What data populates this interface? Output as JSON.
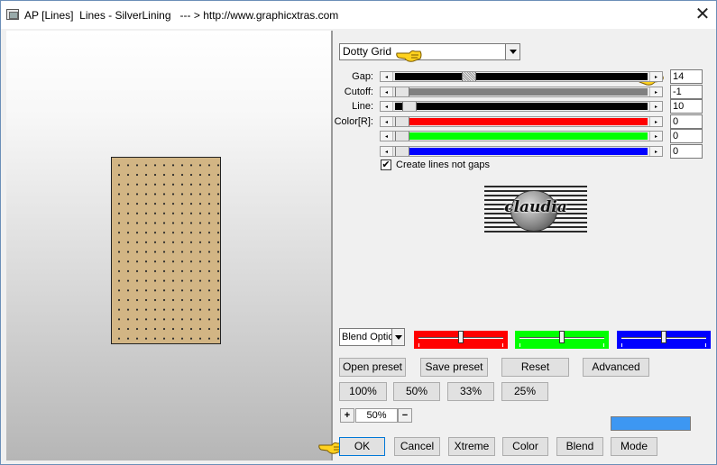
{
  "window": {
    "title": "AP [Lines]  Lines - SilverLining   --- > http://www.graphicxtras.com",
    "close_glyph": "✕"
  },
  "preset_select": {
    "value": "Dotty Grid"
  },
  "sliders": [
    {
      "label": "Gap:",
      "value": "14",
      "fill_color": "#000000",
      "position": 0.28
    },
    {
      "label": "Cutoff:",
      "value": "-1",
      "fill_color": "#808080",
      "position": 0.0
    },
    {
      "label": "Line:",
      "value": "10",
      "fill_color": "#000000",
      "position": 0.03
    },
    {
      "label": "Color[R]:",
      "value": "0",
      "fill_color": "#ff0000",
      "position": 0.0
    },
    {
      "label": "",
      "value": "0",
      "fill_color": "#00ff00",
      "position": 0.0
    },
    {
      "label": "",
      "value": "0",
      "fill_color": "#0000ff",
      "position": 0.0
    }
  ],
  "checkbox": {
    "label": "Create lines not gaps",
    "checked": true,
    "glyph": "✔"
  },
  "logo": {
    "text": "claudia"
  },
  "blend": {
    "select_value": "Blend Optio",
    "channels": [
      {
        "color": "#ff0000",
        "position": 0.5
      },
      {
        "color": "#00ff00",
        "position": 0.5
      },
      {
        "color": "#0000ff",
        "position": 0.5
      }
    ]
  },
  "buttons": {
    "open_preset": "Open preset",
    "save_preset": "Save preset",
    "reset": "Reset",
    "advanced": "Advanced",
    "zoom_100": "100%",
    "zoom_50": "50%",
    "zoom_33": "33%",
    "zoom_25": "25%",
    "ok": "OK",
    "cancel": "Cancel",
    "xtreme": "Xtreme",
    "color": "Color",
    "blend": "Blend",
    "mode": "Mode"
  },
  "zoom": {
    "plus": "+",
    "value": "50%",
    "minus": "−"
  },
  "colors": {
    "swatch": "#3d97f2",
    "preview_fill": "#d2b584"
  }
}
